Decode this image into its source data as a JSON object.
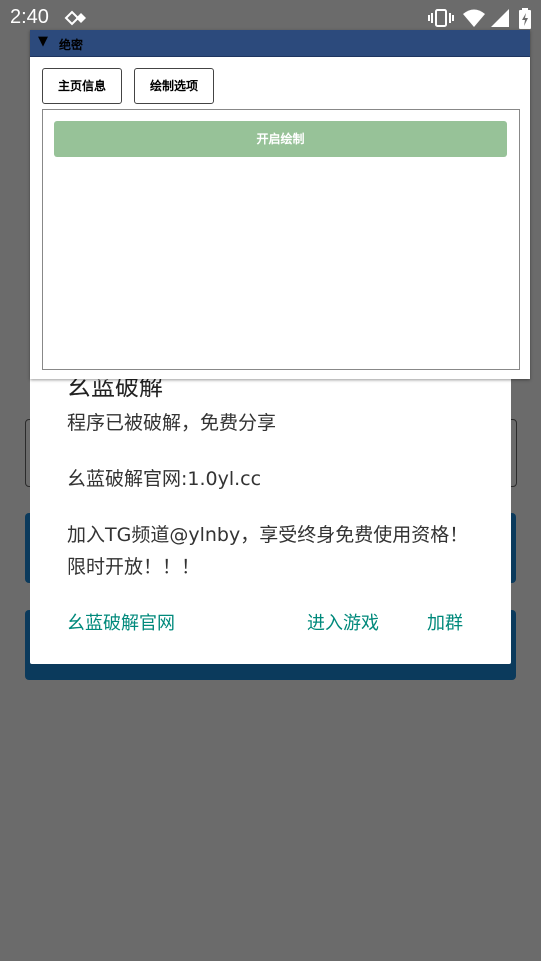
{
  "status_bar": {
    "time": "2:40"
  },
  "floating_window": {
    "title": "绝密",
    "tabs": [
      {
        "label": "主页信息"
      },
      {
        "label": "绘制选项"
      }
    ],
    "draw_button": "开启绘制"
  },
  "dialog": {
    "title": "幺蓝破解",
    "messages": [
      "程序已被破解，免费分享",
      "幺蓝破解官网:1.0yl.cc",
      "加入TG频道@ylnby，享受终身免费使用资格！限时开放！！！"
    ],
    "actions": {
      "website": "幺蓝破解官网",
      "enter_game": "进入游戏",
      "join_group": "加群"
    }
  },
  "colors": {
    "titlebar": "#2c4a7c",
    "draw_button": "#97c298",
    "action_text": "#00897b",
    "background_card": "#0b3a5c"
  }
}
